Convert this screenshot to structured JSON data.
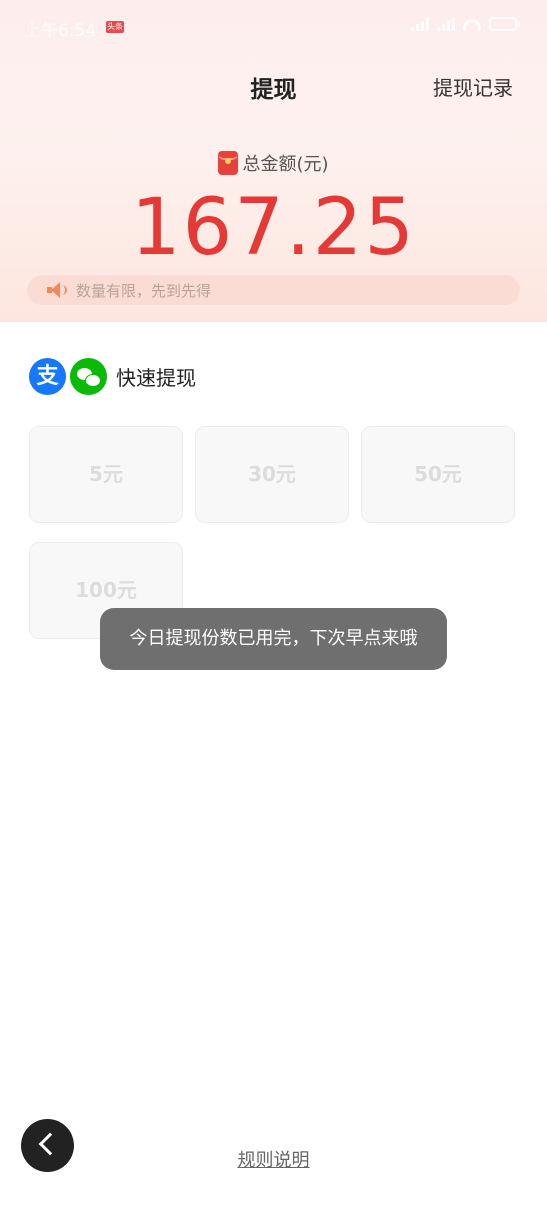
{
  "status_bar": {
    "time": "上午6:54",
    "badge": "头条"
  },
  "header": {
    "title": "提现",
    "record_link": "提现记录"
  },
  "balance": {
    "label": "总金额(元)",
    "amount": "167.25"
  },
  "notice": {
    "text": "数量有限，先到先得"
  },
  "quick_withdraw": {
    "title": "快速提现",
    "alipay_glyph": "支",
    "options": [
      "5元",
      "30元",
      "50元",
      "100元"
    ]
  },
  "toast": {
    "message": "今日提现份数已用完，下次早点来哦"
  },
  "footer": {
    "rules_link": "规则说明"
  },
  "colors": {
    "amount_red": "#e53935",
    "alipay_blue": "#1677ff",
    "wechat_green": "#09bb07"
  }
}
